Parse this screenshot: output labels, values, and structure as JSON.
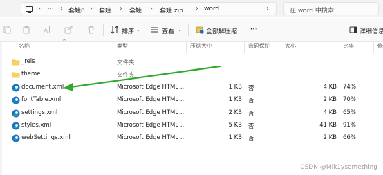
{
  "address_bar": {
    "crumbs": [
      "套娃8",
      "套娃",
      "套娃",
      "套娃.zip",
      "word"
    ],
    "overflow": "···",
    "search_placeholder": "在 word 中搜索"
  },
  "toolbar": {
    "sort_label": "排序",
    "view_label": "查看",
    "extract_all_label": "全部解压缩",
    "more_label": "···",
    "details_label": "详细信息"
  },
  "columns": {
    "name": "名称",
    "type": "类型",
    "compressed_size": "压缩大小",
    "password": "密码保护",
    "size": "大小",
    "ratio": "比率",
    "date": "修"
  },
  "files": [
    {
      "name": "_rels",
      "icon": "folder-icon",
      "type": "文件夹",
      "compressed": "",
      "password": "",
      "size": "",
      "ratio": ""
    },
    {
      "name": "theme",
      "icon": "folder-icon",
      "type": "文件夹",
      "compressed": "",
      "password": "",
      "size": "",
      "ratio": ""
    },
    {
      "name": "document.xml",
      "icon": "edge-icon",
      "type": "Microsoft Edge HTML ...",
      "compressed": "1 KB",
      "password": "否",
      "size": "4 KB",
      "ratio": "74%"
    },
    {
      "name": "fontTable.xml",
      "icon": "edge-icon",
      "type": "Microsoft Edge HTML ...",
      "compressed": "1 KB",
      "password": "否",
      "size": "2 KB",
      "ratio": "70%"
    },
    {
      "name": "settings.xml",
      "icon": "edge-icon",
      "type": "Microsoft Edge HTML ...",
      "compressed": "2 KB",
      "password": "否",
      "size": "4 KB",
      "ratio": "65%"
    },
    {
      "name": "styles.xml",
      "icon": "edge-icon",
      "type": "Microsoft Edge HTML ...",
      "compressed": "5 KB",
      "password": "否",
      "size": "41 KB",
      "ratio": "91%"
    },
    {
      "name": "webSettings.xml",
      "icon": "edge-icon",
      "type": "Microsoft Edge HTML ...",
      "compressed": "1 KB",
      "password": "否",
      "size": "2 KB",
      "ratio": "66%"
    }
  ],
  "annotation": {
    "type": "green-arrow",
    "color": "#2eaa2e"
  },
  "watermark": "CSDN @Mik1ysomething",
  "colors": {
    "folder": "#f4c242",
    "edge_blue": "#1a73c8",
    "edge_green": "#38b24a",
    "arrow": "#2eaa2e"
  }
}
